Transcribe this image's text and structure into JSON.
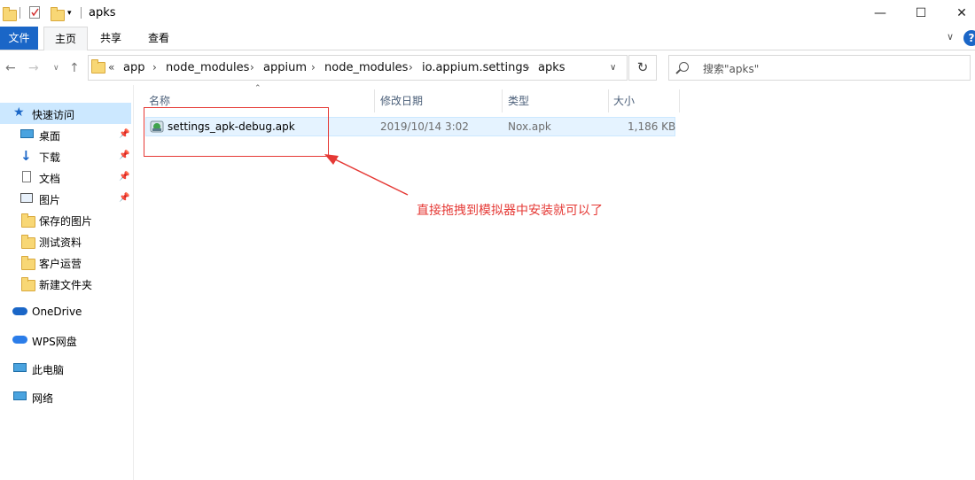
{
  "window": {
    "title": "apks",
    "minimize_glyph": "—",
    "maximize_glyph": "☐",
    "close_glyph": "✕"
  },
  "ribbon": {
    "tabs": [
      "文件",
      "主页",
      "共享",
      "查看"
    ]
  },
  "address": {
    "overflow": "«",
    "crumbs": [
      "app",
      "node_modules",
      "appium",
      "node_modules",
      "io.appium.settings",
      "apks"
    ]
  },
  "search": {
    "placeholder": "搜索\"apks\""
  },
  "sidebar": {
    "quick_access": "快速访问",
    "items": [
      {
        "label": "桌面",
        "icon": "desktop-icon",
        "pinned": true
      },
      {
        "label": "下载",
        "icon": "download-icon",
        "pinned": true
      },
      {
        "label": "文档",
        "icon": "document-icon",
        "pinned": true
      },
      {
        "label": "图片",
        "icon": "picture-icon",
        "pinned": true
      },
      {
        "label": "保存的图片",
        "icon": "folder-icon",
        "pinned": false
      },
      {
        "label": "测试资料",
        "icon": "folder-icon",
        "pinned": false
      },
      {
        "label": "客户运营",
        "icon": "folder-icon",
        "pinned": false
      },
      {
        "label": "新建文件夹",
        "icon": "folder-icon",
        "pinned": false
      }
    ],
    "onedrive": "OneDrive",
    "wps": "WPS网盘",
    "this_pc": "此电脑",
    "network": "网络"
  },
  "columns": {
    "name": "名称",
    "modified": "修改日期",
    "type": "类型",
    "size": "大小"
  },
  "files": [
    {
      "name": "settings_apk-debug.apk",
      "modified": "2019/10/14 3:02",
      "type": "Nox.apk",
      "size": "1,186 KB",
      "icon": "apk-file-icon"
    }
  ],
  "annotation": {
    "text": "直接拖拽到模拟器中安装就可以了",
    "color": "#e53935"
  },
  "colors": {
    "accent": "#1a66c7",
    "selection": "#e5f3ff",
    "annotation": "#e53935"
  }
}
